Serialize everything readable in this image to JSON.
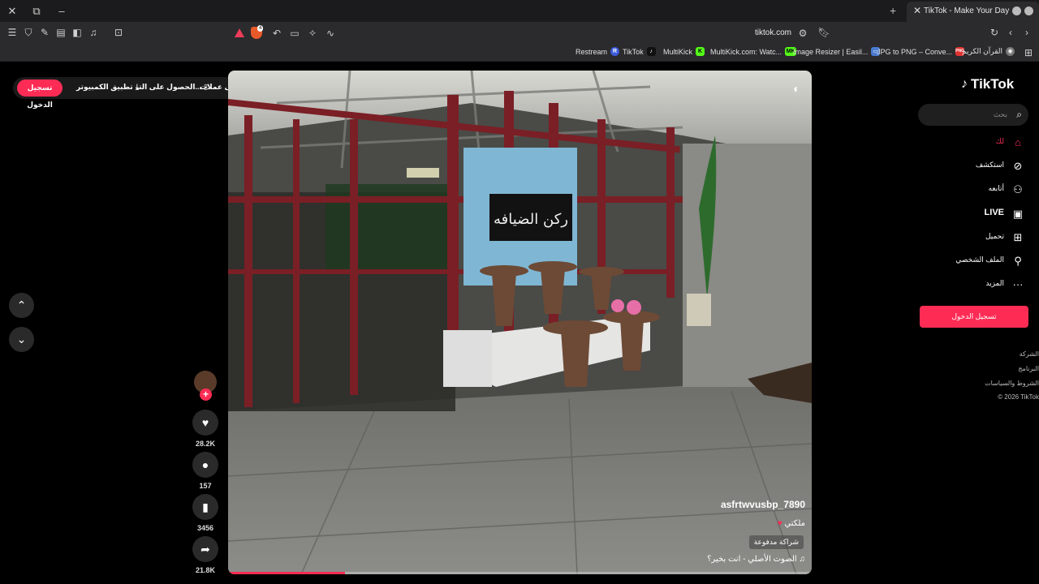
{
  "browser": {
    "tab_title": "TikTok - Make Your Day",
    "url": "tiktok.com",
    "brave_badge": "4",
    "bookmarks": [
      {
        "label": "Restream",
        "icon": "R",
        "color": "#3b5bdb"
      },
      {
        "label": "TikTok",
        "icon": "♪",
        "color": "#111111"
      },
      {
        "label": "MultiKick",
        "icon": "K",
        "color": "#53fc18"
      },
      {
        "label": "MultiKick.com: Watc...",
        "icon": "MK",
        "color": "#53fc18"
      },
      {
        "label": "Image Resizer | Easil...",
        "icon": "▭",
        "color": "#4a7bd0"
      },
      {
        "label": "JPG to PNG – Conve...",
        "icon": "PNG",
        "color": "#e03131"
      },
      {
        "label": "القرآن الكريم",
        "icon": "◉",
        "color": "#777777"
      }
    ]
  },
  "top_pill": {
    "login_label": "تسجيل الدخول",
    "desktop_app_label": "تطبيق الكمبيوتر",
    "get_app_label": "الحصول على التـ...",
    "coins_label": "احصل على عملات"
  },
  "video": {
    "author": "asfrtwvusbp_7890",
    "description": "ملكتي",
    "paid_tag": "شراكة مدفوعة",
    "music": "الصوت الأصلي - انت بخير؟",
    "progress": 0.2
  },
  "actions": {
    "likes": "28.2K",
    "comments": "157",
    "saves": "3456",
    "shares": "21.8K"
  },
  "sidebar": {
    "logo_text": "TikTok",
    "search_placeholder": "بحث",
    "items": [
      {
        "label": "لك",
        "icon": "home-icon",
        "active": true
      },
      {
        "label": "استكشف",
        "icon": "compass-icon",
        "active": false
      },
      {
        "label": "أتابعه",
        "icon": "following-icon",
        "active": false
      },
      {
        "label": "LIVE",
        "icon": "live-icon",
        "active": false
      },
      {
        "label": "تحميل",
        "icon": "upload-icon",
        "active": false
      },
      {
        "label": "الملف الشخصي",
        "icon": "profile-icon",
        "active": false
      },
      {
        "label": "المزيد",
        "icon": "more-icon",
        "active": false
      }
    ],
    "login_label": "تسجيل الدخول",
    "footer": [
      "الشركة",
      "البرنامج",
      "الشروط والسياسات",
      "© 2026 TikTok"
    ]
  },
  "colors": {
    "accent": "#fe2c55",
    "background": "#000000",
    "chrome": "#2b2b2e"
  }
}
